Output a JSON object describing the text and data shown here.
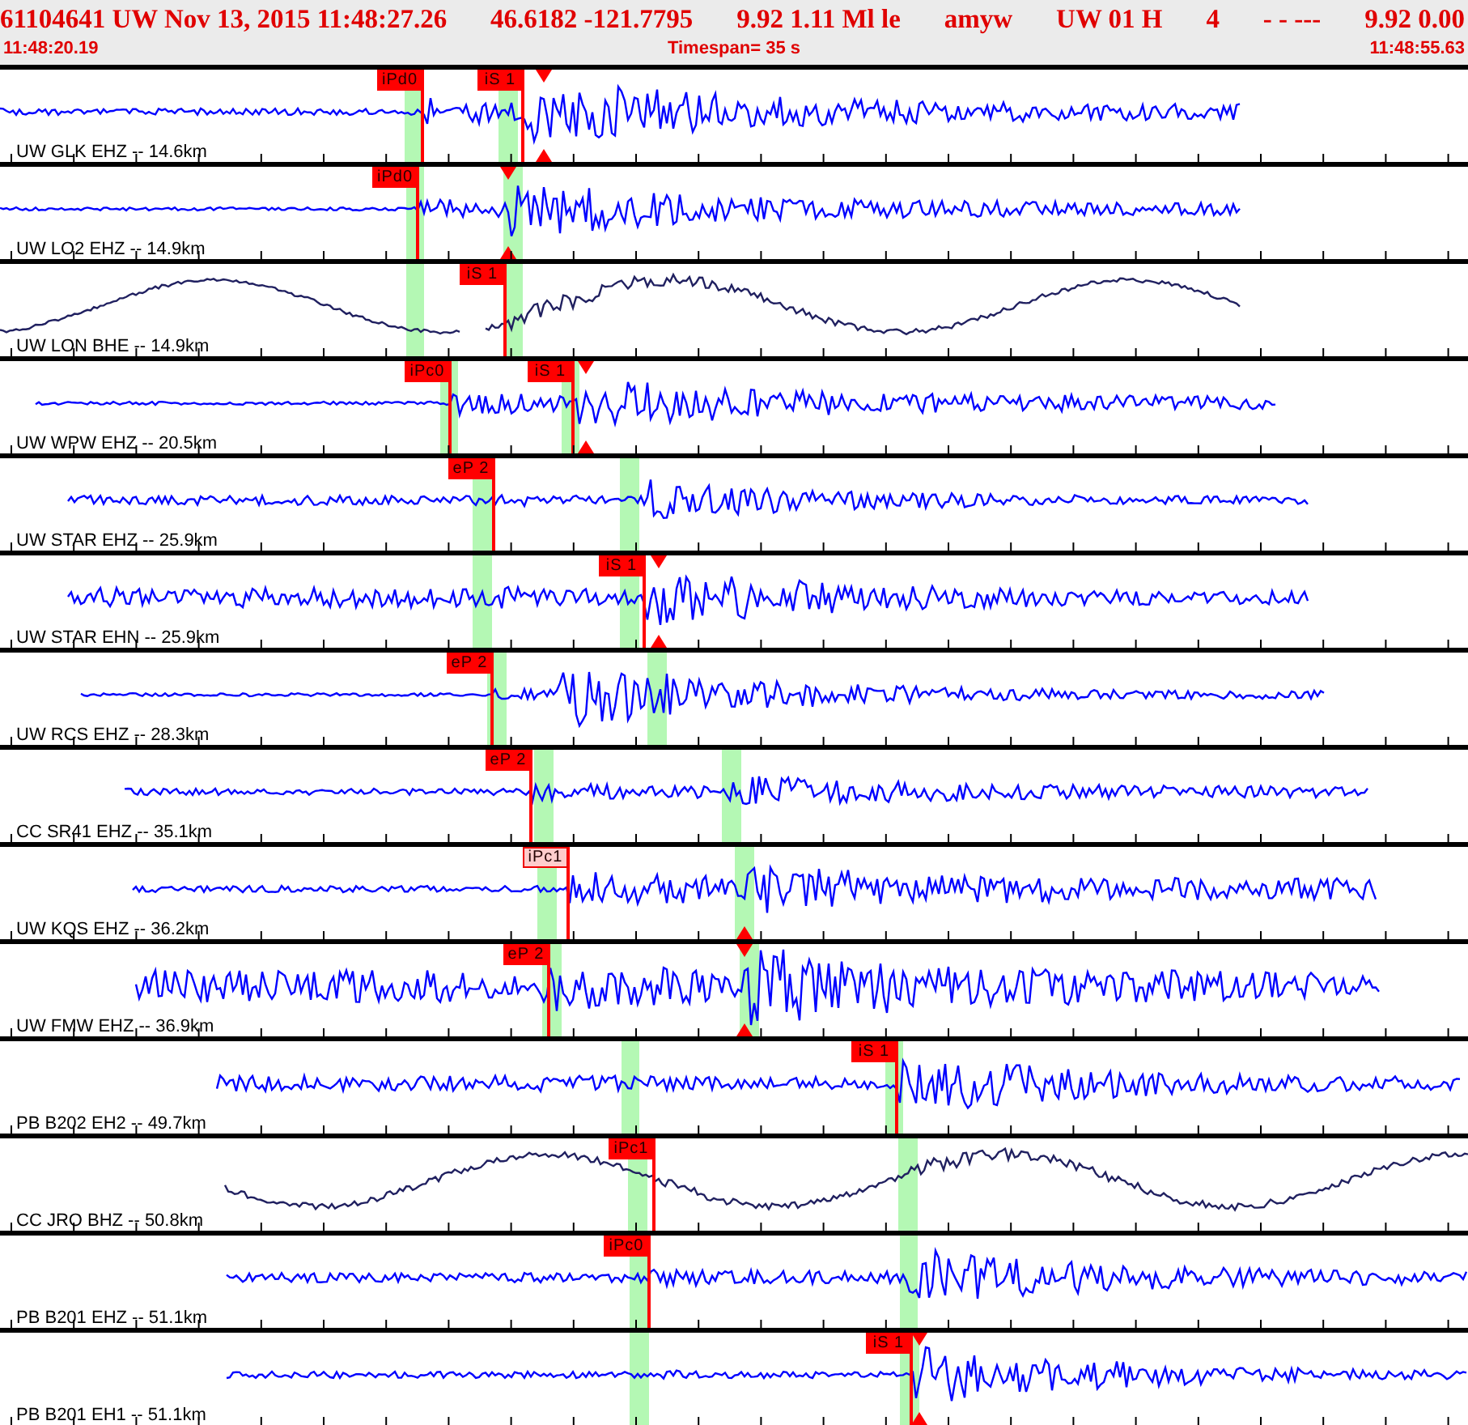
{
  "header": {
    "fields": [
      "61104641 UW Nov 13, 2015 11:48:27.26",
      "46.6182 -121.7795",
      "9.92 1.11 Ml le",
      "amyw",
      "UW 01 H",
      "4",
      "-  - ---",
      "9.92 0.00"
    ],
    "start_time": "11:48:20.19",
    "timespan": "Timespan=  35 s",
    "end_time": "11:48:55.63"
  },
  "traces": [
    {
      "station": "UW GLK EHZ -- 14.6km",
      "color": "#0000ff",
      "picks": [
        {
          "label": "iPd0",
          "selected": false
        },
        {
          "label": "iS 1",
          "selected": false
        }
      ]
    },
    {
      "station": "UW LO2 EHZ -- 14.9km",
      "color": "#0000ff",
      "picks": [
        {
          "label": "iPd0",
          "selected": false
        }
      ]
    },
    {
      "station": "UW LON BHE -- 14.9km",
      "color": "#202060",
      "picks": [
        {
          "label": "iS 1",
          "selected": false
        }
      ]
    },
    {
      "station": "UW WPW EHZ -- 20.5km",
      "color": "#0000ff",
      "picks": [
        {
          "label": "iPc0",
          "selected": false
        },
        {
          "label": "iS 1",
          "selected": false
        }
      ]
    },
    {
      "station": "UW STAR EHZ -- 25.9km",
      "color": "#0000ff",
      "picks": [
        {
          "label": "eP 2",
          "selected": false
        }
      ]
    },
    {
      "station": "UW STAR EHN -- 25.9km",
      "color": "#0000ff",
      "picks": [
        {
          "label": "iS 1",
          "selected": false
        }
      ]
    },
    {
      "station": "UW RCS EHZ -- 28.3km",
      "color": "#0000ff",
      "picks": [
        {
          "label": "eP 2",
          "selected": false
        }
      ]
    },
    {
      "station": "CC SR41 EHZ -- 35.1km",
      "color": "#0000ff",
      "picks": [
        {
          "label": "eP 2",
          "selected": false
        }
      ]
    },
    {
      "station": "UW KQS EHZ -- 36.2km",
      "color": "#0000ff",
      "picks": [
        {
          "label": "iPc1",
          "selected": true
        }
      ]
    },
    {
      "station": "UW FMW EHZ -- 36.9km",
      "color": "#0000ff",
      "picks": [
        {
          "label": "eP 2",
          "selected": false
        }
      ]
    },
    {
      "station": "PB B202 EH2 -- 49.7km",
      "color": "#0000ff",
      "picks": [
        {
          "label": "iS 1",
          "selected": false
        }
      ]
    },
    {
      "station": "CC JRO BHZ -- 50.8km",
      "color": "#202060",
      "picks": [
        {
          "label": "iPc1",
          "selected": false
        }
      ]
    },
    {
      "station": "PB B201 EHZ -- 51.1km",
      "color": "#0000ff",
      "picks": [
        {
          "label": "iPc0",
          "selected": false
        }
      ]
    },
    {
      "station": "PB B201 EH1 -- 51.1km",
      "color": "#0000ff",
      "picks": [
        {
          "label": "iS 1",
          "selected": false
        }
      ]
    }
  ]
}
